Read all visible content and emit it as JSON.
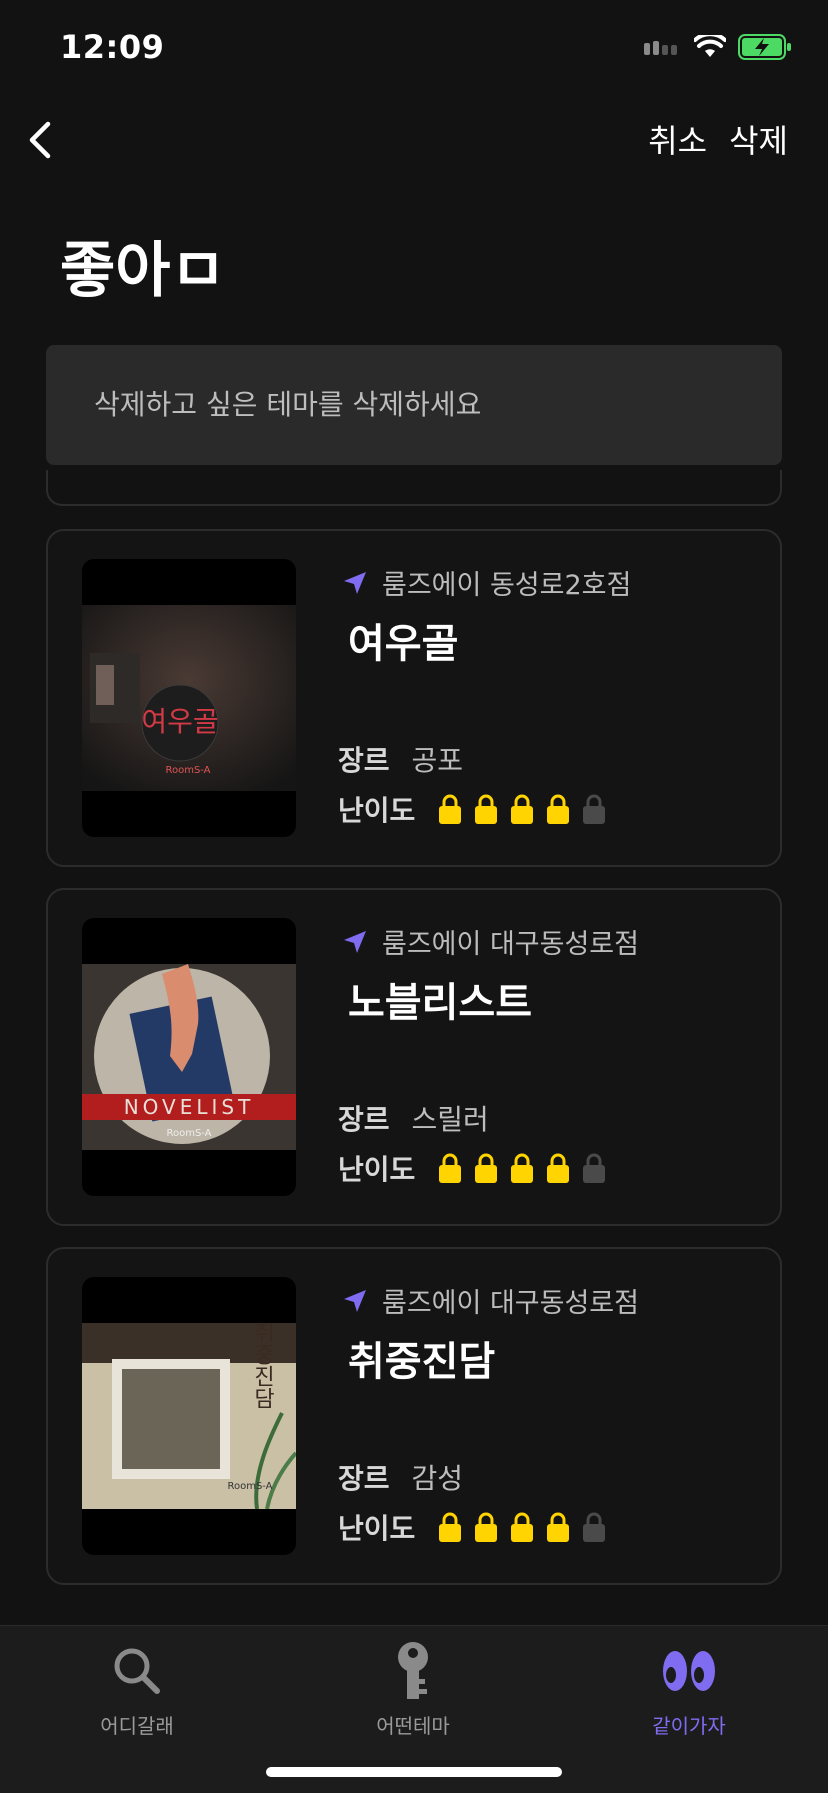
{
  "status": {
    "time": "12:09"
  },
  "nav": {
    "cancel_label": "취소",
    "delete_label": "삭제"
  },
  "page": {
    "title": "좋아ㅁ"
  },
  "hint": {
    "text": "삭제하고 싶은 테마를 삭제하세요"
  },
  "labels": {
    "genre": "장르",
    "difficulty": "난이도"
  },
  "cards": [
    {
      "location": "룸즈에이 동성로2호점",
      "title": "여우골",
      "genre": "공포",
      "difficulty": 4,
      "max_difficulty": 5,
      "poster_text": "여우골"
    },
    {
      "location": "룸즈에이 대구동성로점",
      "title": "노블리스트",
      "genre": "스릴러",
      "difficulty": 4,
      "max_difficulty": 5,
      "poster_text": "NOVELIST"
    },
    {
      "location": "룸즈에이 대구동성로점",
      "title": "취중진담",
      "genre": "감성",
      "difficulty": 4,
      "max_difficulty": 5,
      "poster_text": "취중진담"
    }
  ],
  "tabs": [
    {
      "label": "어디갈래",
      "icon": "search-icon",
      "active": false
    },
    {
      "label": "어떤테마",
      "icon": "key-icon",
      "active": false
    },
    {
      "label": "같이가자",
      "icon": "eyes-icon",
      "active": true
    }
  ],
  "colors": {
    "accent": "#7f6cf0",
    "lock_on": "#ffd400",
    "lock_off": "#4a4a4a",
    "background": "#121212"
  }
}
